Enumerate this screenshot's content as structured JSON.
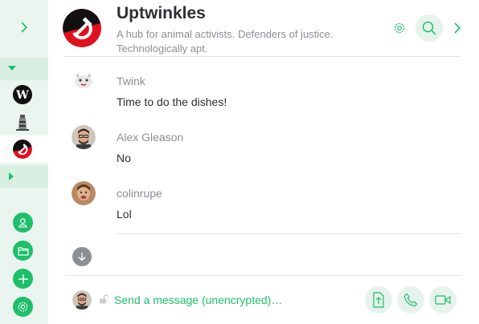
{
  "room": {
    "name": "Uptwinkles",
    "topic": "A hub for animal activists. Defenders of justice. Technologically apt."
  },
  "sidebar": {
    "rooms": [
      {
        "name": "W",
        "icon": "w-letter-avatar"
      },
      {
        "name": "lighthouse",
        "icon": "lighthouse-avatar"
      },
      {
        "name": "Uptwinkles",
        "icon": "hammer-sickle-avatar"
      }
    ],
    "buttons": [
      "profile-icon",
      "folder-icon",
      "plus-icon",
      "gear-icon"
    ]
  },
  "messages": [
    {
      "sender": "Twink",
      "body": "Time to do the dishes!"
    },
    {
      "sender": "Alex Gleason",
      "body": "No"
    },
    {
      "sender": "colinrupe",
      "body": "Lol"
    }
  ],
  "composer": {
    "placeholder": "Send a message (unencrypted)…"
  },
  "colors": {
    "accent": "#1dbf6a",
    "sidebar_bg": "#eaf5ef",
    "text": "#2e2f32",
    "muted": "#8c8f94",
    "room_red": "#e0101e"
  }
}
